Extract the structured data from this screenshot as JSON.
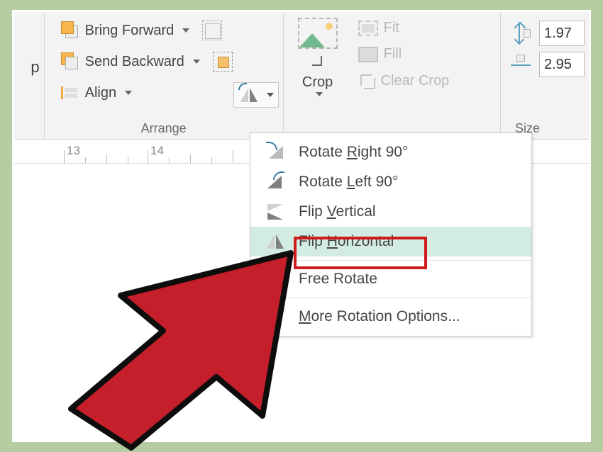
{
  "ribbon": {
    "arrange": {
      "label": "Arrange",
      "bring_forward": "Bring Forward",
      "send_backward": "Send Backward",
      "align": "Align"
    },
    "crop": {
      "label": "Crop",
      "fit": "Fit",
      "fill": "Fill",
      "clear": "Clear Crop"
    },
    "size": {
      "label": "Size",
      "height": "1.97",
      "width": "2.95"
    },
    "partial_left": "p"
  },
  "ruler": {
    "n13": "13",
    "n14": "14"
  },
  "menu": {
    "rotate_right_pre": "Rotate ",
    "rotate_right_u": "R",
    "rotate_right_post": "ight 90°",
    "rotate_left_pre": "Rotate ",
    "rotate_left_u": "L",
    "rotate_left_post": "eft 90°",
    "flip_v_pre": "Flip ",
    "flip_v_u": "V",
    "flip_v_post": "ertical",
    "flip_h_pre": "Flip ",
    "flip_h_u": "H",
    "flip_h_post": "orizontal",
    "free_rotate": "Free Rotate",
    "more_pre": "",
    "more_u": "M",
    "more_post": "ore Rotation Options..."
  }
}
